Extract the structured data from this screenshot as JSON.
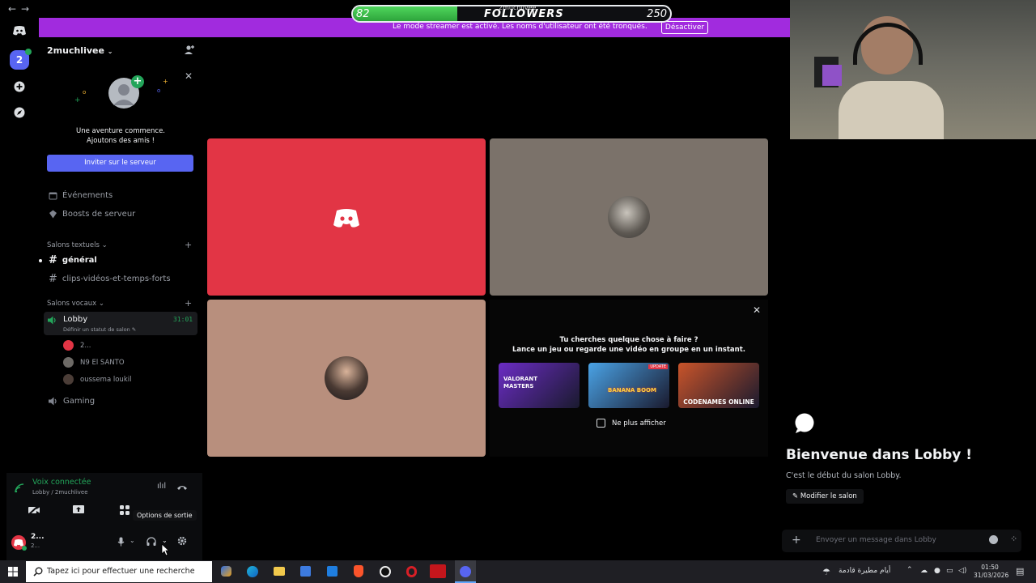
{
  "streamer_bar": {
    "message": "Le mode streamer est activé. Les noms d'utilisateur ont été tronqués.",
    "disable_label": "Désactiver"
  },
  "followers": {
    "current": "82",
    "label": "FOLLOWERS",
    "sublabel": "2muchlivee",
    "goal": "250",
    "progress_fraction": 0.33
  },
  "server": {
    "name": "2muchlivee",
    "rail_badge": "2"
  },
  "invite_card": {
    "text_line1": "Une aventure commence.",
    "text_line2": "Ajoutons des amis !",
    "button": "Inviter sur le serveur"
  },
  "sidebar": {
    "events": "Événements",
    "boosts": "Boosts de serveur",
    "text_category": "Salons textuels",
    "text_channels": [
      "général",
      "clips-vidéos-et-temps-forts"
    ],
    "voice_category": "Salons vocaux",
    "lobby": {
      "name": "Lobby",
      "timer": "31:01",
      "status": "Définir un statut de salon",
      "members": [
        "2...",
        "N9 El SANTO",
        "oussema loukil"
      ]
    },
    "gaming": "Gaming"
  },
  "voice_panel": {
    "status": "Voix connectée",
    "location": "Lobby / 2muchlivee"
  },
  "user_panel": {
    "name": "2...",
    "sub": "2...",
    "tooltip": "Options de sortie"
  },
  "activity": {
    "line1": "Tu cherches quelque chose à faire ?",
    "line2": "Lance un jeu ou regarde une vidéo en groupe en un instant.",
    "games": [
      {
        "title": "VALORANT MASTERS",
        "color": "#6b2cc4"
      },
      {
        "title": "BANANA BOOM",
        "color": "#4aa3e6",
        "badge": "UPDATE"
      },
      {
        "title": "CODENAMES ONLINE",
        "color": "#c9542a"
      }
    ],
    "dont_show": "Ne plus afficher"
  },
  "chat": {
    "welcome": "Bienvenue dans Lobby !",
    "start": "C'est le début du salon Lobby.",
    "edit": "Modifier le salon",
    "placeholder": "Envoyer un message dans Lobby"
  },
  "taskbar": {
    "search": "Tapez ici pour effectuer une recherche",
    "weather": "أيام مطيرة قادمة",
    "time": "01:50",
    "date": "31/03/2026"
  },
  "colors": {
    "accent": "#5865f2",
    "streamer": "#a12bde",
    "voice_green": "#23a55a",
    "tile_red": "#e23545"
  }
}
